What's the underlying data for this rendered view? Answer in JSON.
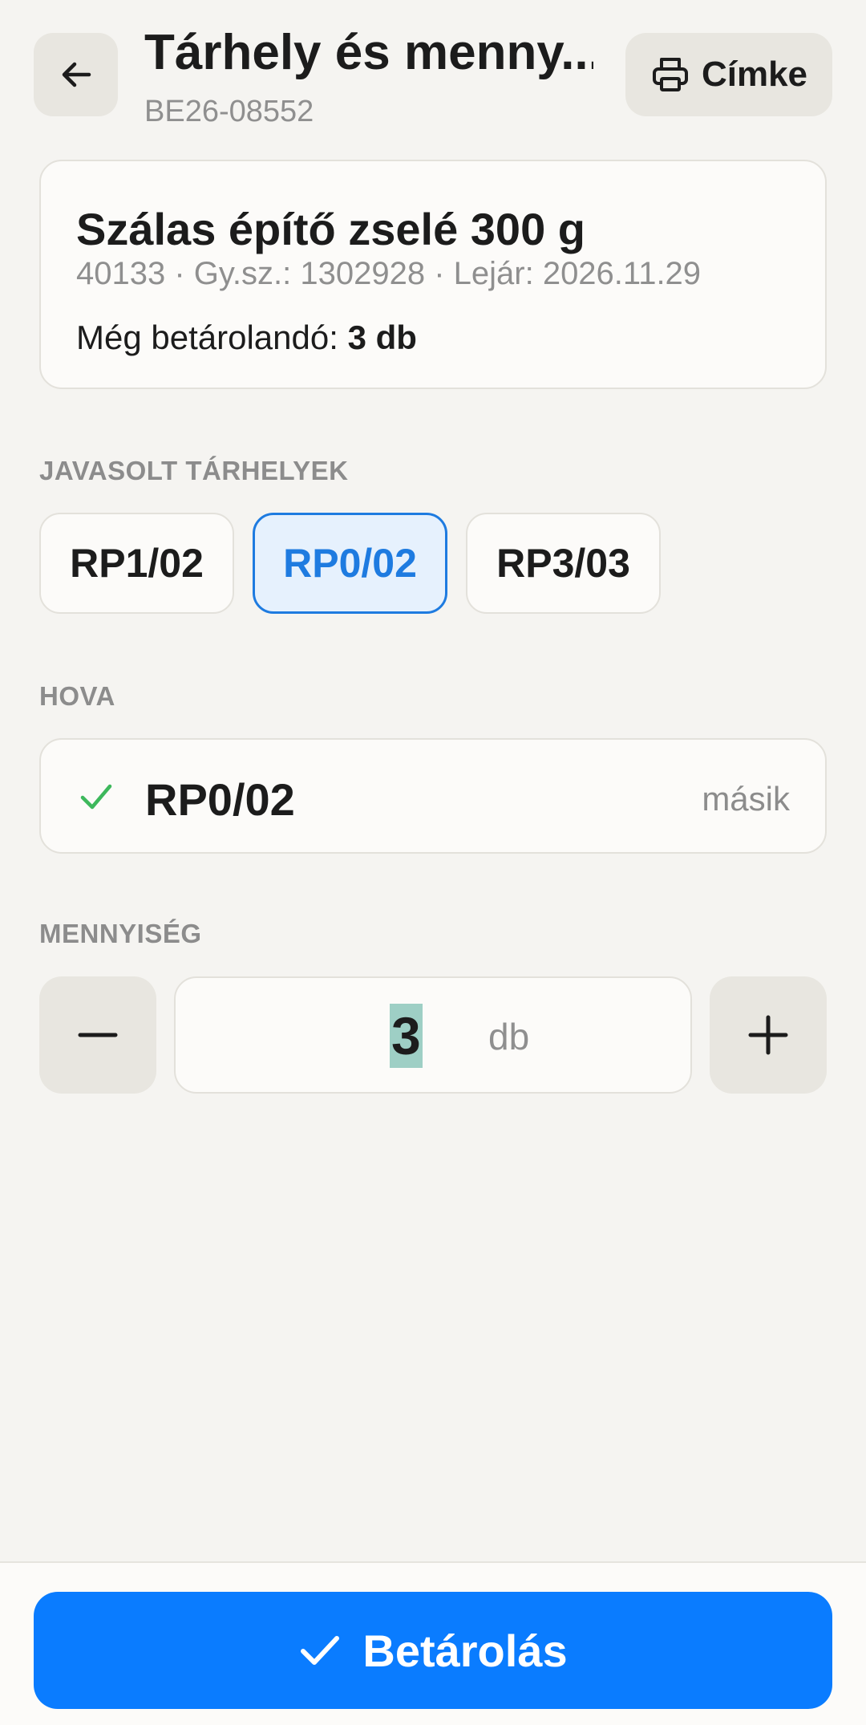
{
  "header": {
    "title": "Tárhely és menny...",
    "subtitle": "BE26-08552",
    "print_label": "Címke"
  },
  "product": {
    "name": "Szálas építő zselé 300 g",
    "meta": "40133 · Gy.sz.: 1302928 · Lejár: 2026.11.29",
    "remaining_label": "Még betárolandó: ",
    "remaining_value": "3 db"
  },
  "suggested": {
    "label": "JAVASOLT TÁRHELYEK",
    "items": [
      {
        "label": "RP1/02",
        "selected": false
      },
      {
        "label": "RP0/02",
        "selected": true
      },
      {
        "label": "RP3/03",
        "selected": false
      }
    ]
  },
  "destination": {
    "label": "HOVA",
    "value": "RP0/02",
    "other_label": "másik"
  },
  "quantity": {
    "label": "MENNYISÉG",
    "value": "3",
    "unit": "db"
  },
  "submit": {
    "label": "Betárolás"
  },
  "colors": {
    "accent": "#0a7cff",
    "selected_chip": "#1e7be0",
    "check_green": "#3db85c"
  }
}
